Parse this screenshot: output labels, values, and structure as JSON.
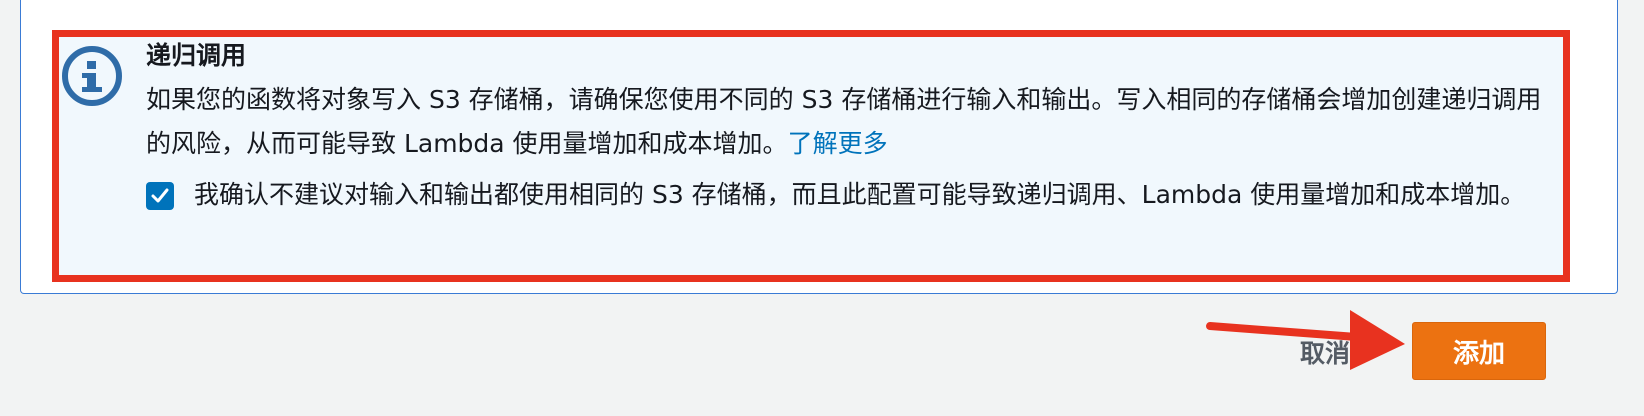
{
  "alert": {
    "icon": "info-icon",
    "title": "递归调用",
    "text": "如果您的函数将对象写入 S3 存储桶，请确保您使用不同的 S3 存储桶进行输入和输出。写入相同的存储桶会增加创建递归调用的风险，从而可能导致 Lambda 使用量增加和成本增加。",
    "link_label": "了解更多"
  },
  "acknowledge": {
    "checked": true,
    "label": "我确认不建议对输入和输出都使用相同的 S3 存储桶，而且此配置可能导致递归调用、Lambda 使用量增加和成本增加。"
  },
  "actions": {
    "cancel_label": "取消",
    "add_label": "添加"
  },
  "colors": {
    "highlight": "#e8321f",
    "accent": "#0073bb",
    "primary_button": "#ec7211",
    "alert_bg": "#f1f8fd"
  }
}
